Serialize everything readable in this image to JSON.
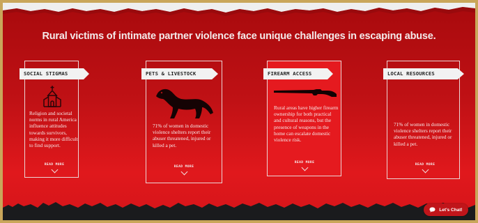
{
  "headline": "Rural victims of intimate partner violence face unique challenges in escaping abuse.",
  "cards": [
    {
      "tag": "SOCIAL STIGMAS",
      "icon": "church-icon",
      "text": "Religion and societal norms in rural America influence attitudes towards survivors, making it more difficult to find support.",
      "readmore": "READ MORE"
    },
    {
      "tag": "PETS & LIVESTOCK",
      "icon": "ferret-icon",
      "text": "71% of women in domestic violence shelters report their abuser threatened, injured or killed a pet.",
      "readmore": "READ MORE"
    },
    {
      "tag": "FIREARM ACCESS",
      "icon": "shotgun-icon",
      "text": "Rural areas have higher firearm ownership for both practical and cultural reasons, but the presence of weapons in the home can escalate domestic violence risk.",
      "readmore": "READ MORE"
    },
    {
      "tag": "LOCAL RESOURCES",
      "icon": "",
      "text": "71% of women in domestic violence shelters report their abuser threatened, injured or killed a pet.",
      "readmore": "READ MORE"
    }
  ],
  "chat": {
    "label": "Let's Chat!",
    "icon": "chat-bubble-icon"
  },
  "colors": {
    "background": "#c01115",
    "highlight_card": "#e51a1f",
    "text": "#f4eaea"
  }
}
